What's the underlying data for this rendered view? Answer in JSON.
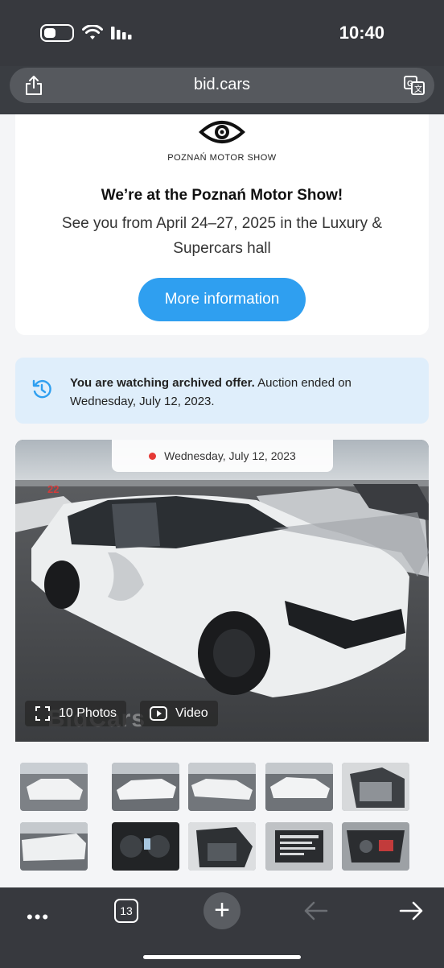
{
  "status_bar": {
    "time": "10:40"
  },
  "browser": {
    "url": "bid.cars",
    "tabs_count": "13"
  },
  "promo": {
    "logo_text": "POZNAŃ MOTOR SHOW",
    "title": "We’re at the Poznań Motor Show!",
    "subtitle": "See you from April 24–27, 2025 in the Luxury & Supercars hall",
    "button_label": "More information"
  },
  "archived": {
    "bold_text": "You are watching archived offer.",
    "rest_text": " Auction ended on Wednesday, July 12, 2023."
  },
  "gallery": {
    "date": "Wednesday, July 12, 2023",
    "watermark": "BidCars",
    "photos_label": "10 Photos",
    "video_label": "Video",
    "lot_number": "22"
  },
  "colors": {
    "accent": "#2f9ff0",
    "notice_bg": "#dfeefb",
    "live_dot": "#e53935"
  }
}
